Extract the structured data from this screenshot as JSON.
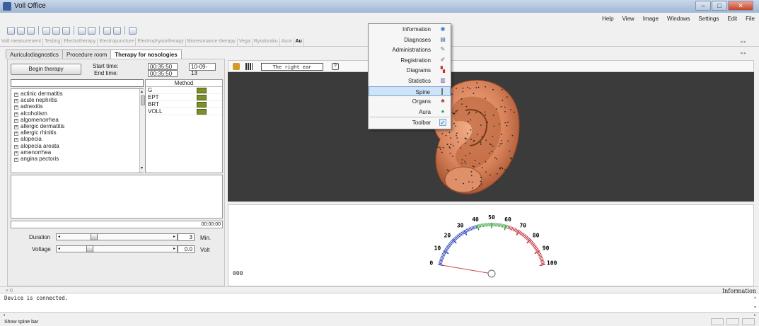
{
  "window": {
    "title": "Voll Office"
  },
  "menubar": [
    "Help",
    "View",
    "Image",
    "Windows",
    "Settings",
    "Edit",
    "File"
  ],
  "tabs_top": [
    "Voll measurement",
    "Testing",
    "Electrotherapy",
    "Electropuncture",
    "Electrophysiotherapy",
    "Bioresonance therapy",
    "Vega",
    "Ryodoraku",
    "Aura",
    "Au"
  ],
  "tabs_sub": [
    "Auriculodiagnostics",
    "Procedure room",
    "Therapy for nosologies"
  ],
  "therapy": {
    "begin_label": "Begin therapy",
    "start_label": "Start time:",
    "end_label": "End time:",
    "start_time": "00:35:50",
    "end_time": "00:35:50",
    "date": "10-09-13"
  },
  "nosologies": [
    "actinic dermatitis",
    "acute nephritis",
    "adnexitis",
    "alcoholism",
    "algomenorrhea",
    "allergic dermatitis",
    "allergic rhinitis",
    "alopecia",
    "alopecia areata",
    "amenorrhea",
    "angina pectoris"
  ],
  "method": {
    "header": "Method",
    "rows": [
      "G",
      "EPT",
      "BRT",
      "VOLL"
    ]
  },
  "progress_time": "00:00:00",
  "duration": {
    "label": "Duration",
    "value": "3",
    "unit": "Min.",
    "level": 0.24
  },
  "voltage": {
    "label": "Voltage",
    "value": "0.0",
    "unit": "Volt",
    "level": 0.2
  },
  "ear": {
    "label": "The right ear"
  },
  "gauge": {
    "ticks": [
      "0",
      "10",
      "20",
      "30",
      "40",
      "50",
      "60",
      "70",
      "80",
      "90",
      "100"
    ],
    "value": 0,
    "readout": "000",
    "colors": {
      "low": "#2b3fb6",
      "mid": "#3aa03a",
      "high": "#c0303a"
    }
  },
  "dropdown": [
    {
      "label": "Information",
      "icon": "globe-icon"
    },
    {
      "label": "Diagnoses",
      "icon": "book-icon"
    },
    {
      "label": "Administrations",
      "icon": "pen-icon"
    },
    {
      "label": "Registration",
      "icon": "register-icon"
    },
    {
      "label": "Diagrams",
      "icon": "diagram-icon"
    },
    {
      "label": "Statistics",
      "icon": "statistics-icon"
    },
    {
      "label": "Spine",
      "icon": "spine-icon",
      "highlighted": true
    },
    {
      "label": "Organs",
      "icon": "organs-icon"
    },
    {
      "label": "Aura",
      "icon": "aura-icon"
    },
    {
      "label": "Toolbar",
      "icon": "check-icon",
      "checked": true
    }
  ],
  "info_panel": {
    "title": "Information",
    "close_glyph": "× 0",
    "log": "Device is connected."
  },
  "status": "Show spine bar"
}
